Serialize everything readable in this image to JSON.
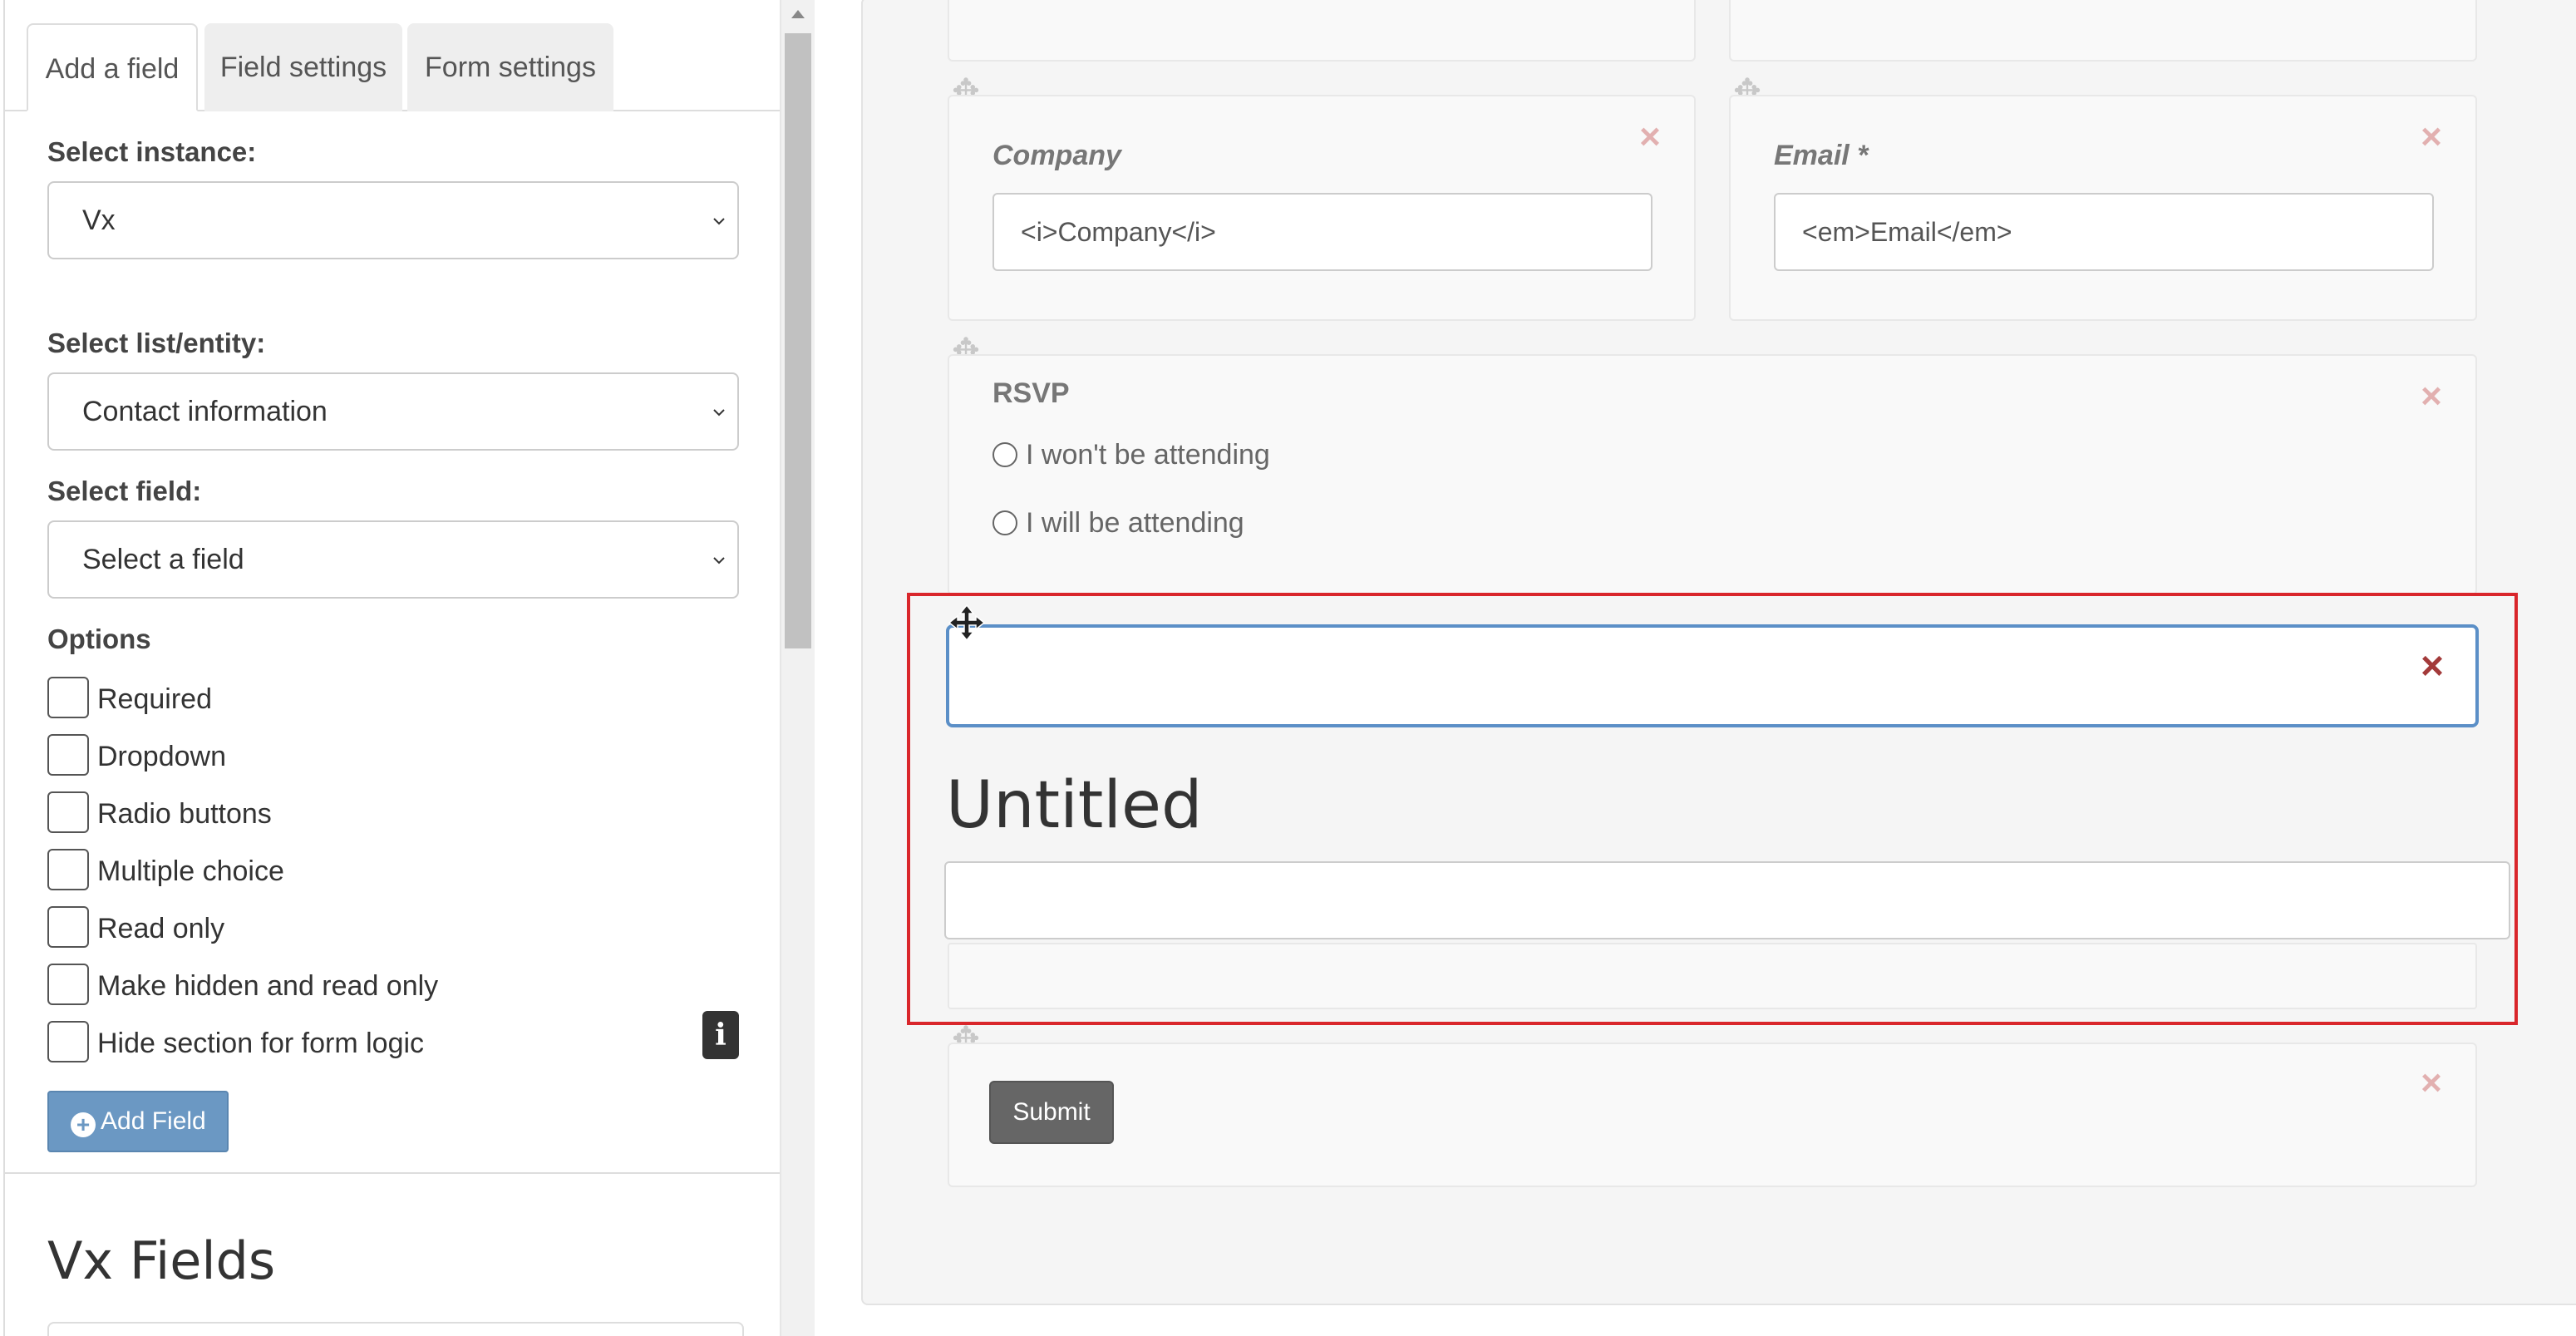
{
  "sidebar": {
    "tabs": [
      "Add a field",
      "Field settings",
      "Form settings"
    ],
    "active_tab": "Add a field",
    "select_instance_label": "Select instance:",
    "select_instance_value": "Vx",
    "select_list_label": "Select list/entity:",
    "select_list_value": "Contact information",
    "select_field_label": "Select field:",
    "select_field_value": "Select a field",
    "options_label": "Options",
    "options": [
      "Required",
      "Dropdown",
      "Radio buttons",
      "Multiple choice",
      "Read only",
      "Make hidden and read only",
      "Hide section for form logic"
    ],
    "add_field_button": "Add Field",
    "info_icon": "i",
    "fields_title": "Vx Fields"
  },
  "form": {
    "company_label": "Company",
    "company_value": "<i>Company</i>",
    "email_label": "Email *",
    "email_value": "<em>Email</em>",
    "rsvp_label": "RSVP",
    "rsvp_options": [
      "I won't be attending",
      "I will be attending"
    ],
    "new_section_title": "Untitled",
    "submit_button": "Submit"
  },
  "icons": {
    "move": "move-icon",
    "close": "close-icon",
    "info": "info-icon",
    "plus": "plus-circle-icon",
    "caret": "chevron-down-icon"
  },
  "colors": {
    "highlight_border": "#d9262b",
    "active_field_border": "#5b8fc7",
    "add_field_button": "#6b98c3",
    "submit_button": "#666666",
    "close_faded": "#e2b0b0",
    "close_active": "#a33a3a"
  }
}
